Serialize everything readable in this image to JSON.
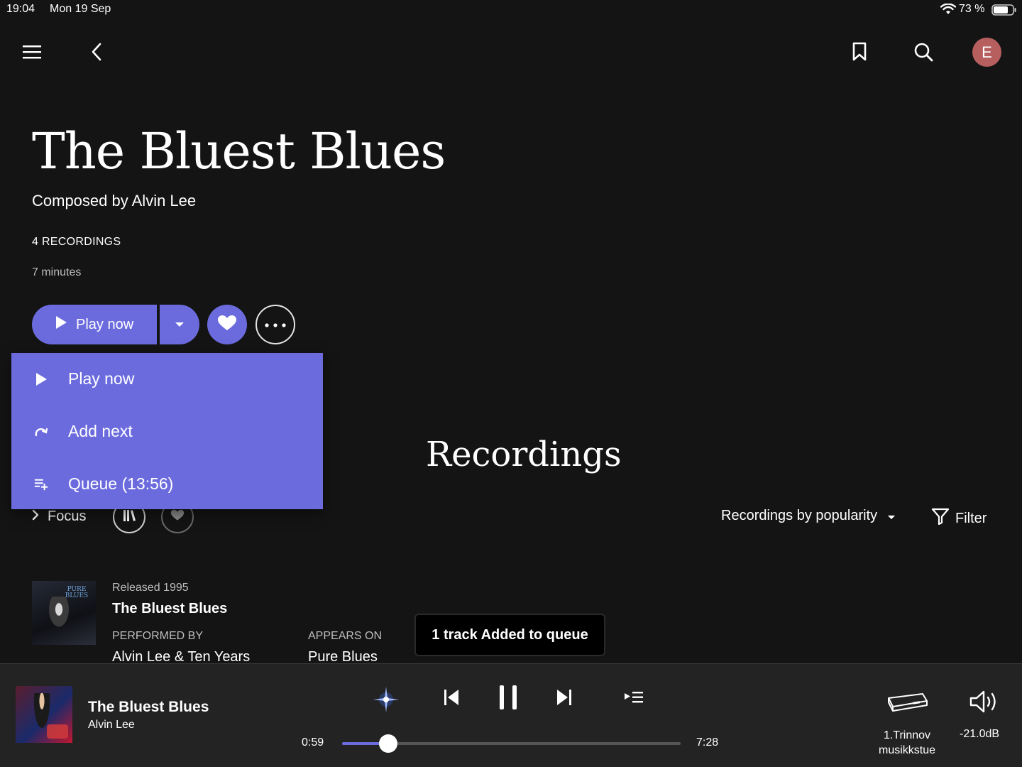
{
  "status_bar": {
    "time": "19:04",
    "date": "Mon 19 Sep",
    "battery": "73 %"
  },
  "header": {
    "menu_icon": "hamburger-icon",
    "back_icon": "chevron-left-icon",
    "bookmark_icon": "bookmark-icon",
    "search_icon": "search-icon",
    "avatar_letter": "E",
    "avatar_color": "#b75f5f"
  },
  "composition": {
    "title": "The Bluest Blues",
    "composer": "Composed by Alvin Lee",
    "recordings_count": "4 RECORDINGS",
    "duration": "7 minutes"
  },
  "actions": {
    "play_label": "Play now",
    "accent_color": "#6b6bde"
  },
  "play_menu": {
    "items": [
      {
        "label": "Play now",
        "icon": "play-icon"
      },
      {
        "label": "Add next",
        "icon": "add-next-icon"
      },
      {
        "label": "Queue (13:56)",
        "icon": "queue-add-icon"
      }
    ]
  },
  "recordings": {
    "heading": "Recordings",
    "focus_label": "Focus",
    "sort_label": "Recordings by popularity",
    "filter_label": "Filter",
    "items": [
      {
        "released": "Released 1995",
        "title": "The Bluest Blues",
        "performed_by_label": "PERFORMED BY",
        "performed_by": "Alvin Lee & Ten Years",
        "appears_on_label": "APPEARS ON",
        "appears_on": "Pure Blues",
        "art_text": "PURE BLUES"
      }
    ]
  },
  "toast": {
    "message": "1 track Added to queue"
  },
  "player": {
    "title": "The Bluest Blues",
    "artist": "Alvin Lee",
    "elapsed": "0:59",
    "total": "7:28",
    "progress_fraction": 0.137,
    "device": "1.Trinnov musikkstue",
    "volume": "-21.0dB"
  }
}
